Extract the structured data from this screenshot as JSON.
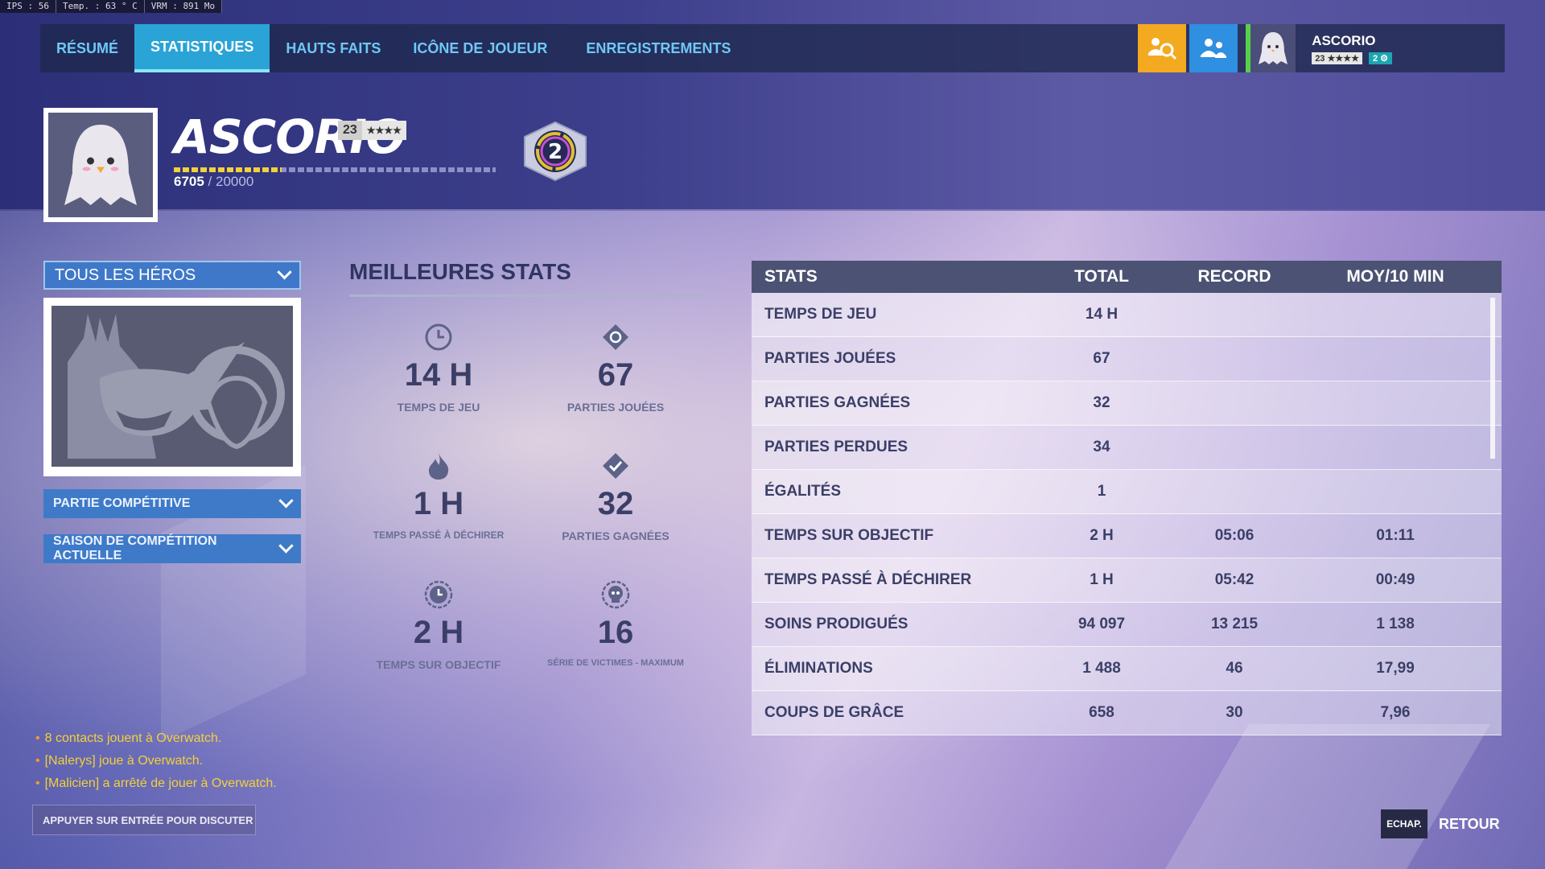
{
  "hud": {
    "fps": "IPS : 56",
    "temp": "Temp. : 63 ° C",
    "vram": "VRM : 891 Mo"
  },
  "nav": {
    "tabs": [
      {
        "label": "RÉSUMÉ"
      },
      {
        "label": "STATISTIQUES"
      },
      {
        "label": "HAUTS FAITS"
      },
      {
        "label": "ICÔNE DE JOUEUR"
      },
      {
        "label": "ENREGISTREMENTS"
      }
    ],
    "active_tab": "STATISTIQUES",
    "icons": [
      "group-search-icon",
      "friends-icon"
    ],
    "profile": {
      "name": "ASCORIO",
      "level": "23",
      "stars": "★★★★",
      "rank": "2 ⚙"
    }
  },
  "player": {
    "name": "ASCORIO",
    "level": "23",
    "stars": "★★★★",
    "xp_current": "6705",
    "xp_sep": " / ",
    "xp_max": "20000",
    "xp_fraction": 0.335,
    "prestige_rank": "2"
  },
  "filters": {
    "hero": "TOUS LES HÉROS",
    "mode": "PARTIE COMPÉTITIVE",
    "season": "SAISON DE COMPÉTITION ACTUELLE"
  },
  "best_stats": {
    "title": "MEILLEURES STATS",
    "items": [
      {
        "value": "14 H",
        "label": "TEMPS DE JEU",
        "icon": "clock-icon"
      },
      {
        "value": "67",
        "label": "PARTIES JOUÉES",
        "icon": "diamond-gear-icon"
      },
      {
        "value": "1 H",
        "label": "TEMPS PASSÉ À DÉCHIRER",
        "icon": "flame-icon"
      },
      {
        "value": "32",
        "label": "PARTIES GAGNÉES",
        "icon": "diamond-check-icon"
      },
      {
        "value": "2 H",
        "label": "TEMPS SUR OBJECTIF",
        "icon": "objective-clock-icon"
      },
      {
        "value": "16",
        "label": "SÉRIE DE VICTIMES - MAXIMUM",
        "icon": "skull-icon"
      }
    ]
  },
  "table": {
    "headers": [
      "STATS",
      "TOTAL",
      "RECORD",
      "MOY/10 MIN"
    ],
    "rows": [
      [
        "TEMPS DE JEU",
        "14 H",
        "",
        ""
      ],
      [
        "PARTIES JOUÉES",
        "67",
        "",
        ""
      ],
      [
        "PARTIES GAGNÉES",
        "32",
        "",
        ""
      ],
      [
        "PARTIES PERDUES",
        "34",
        "",
        ""
      ],
      [
        "ÉGALITÉS",
        "1",
        "",
        ""
      ],
      [
        "TEMPS SUR OBJECTIF",
        "2 H",
        "05:06",
        "01:11"
      ],
      [
        "TEMPS PASSÉ À DÉCHIRER",
        "1 H",
        "05:42",
        "00:49"
      ],
      [
        "SOINS PRODIGUÉS",
        "94 097",
        "13 215",
        "1 138"
      ],
      [
        "ÉLIMINATIONS",
        "1 488",
        "46",
        "17,99"
      ],
      [
        "COUPS DE GRÂCE",
        "658",
        "30",
        "7,96"
      ]
    ]
  },
  "chat": {
    "messages": [
      "8 contacts jouent à Overwatch.",
      "[Nalerys] joue à Overwatch.",
      "[Malicien] a arrêté de jouer à Overwatch."
    ],
    "prompt": "APPUYER SUR ENTRÉE POUR DISCUTER"
  },
  "footer": {
    "esc": "ECHAP.",
    "back": "RETOUR"
  }
}
